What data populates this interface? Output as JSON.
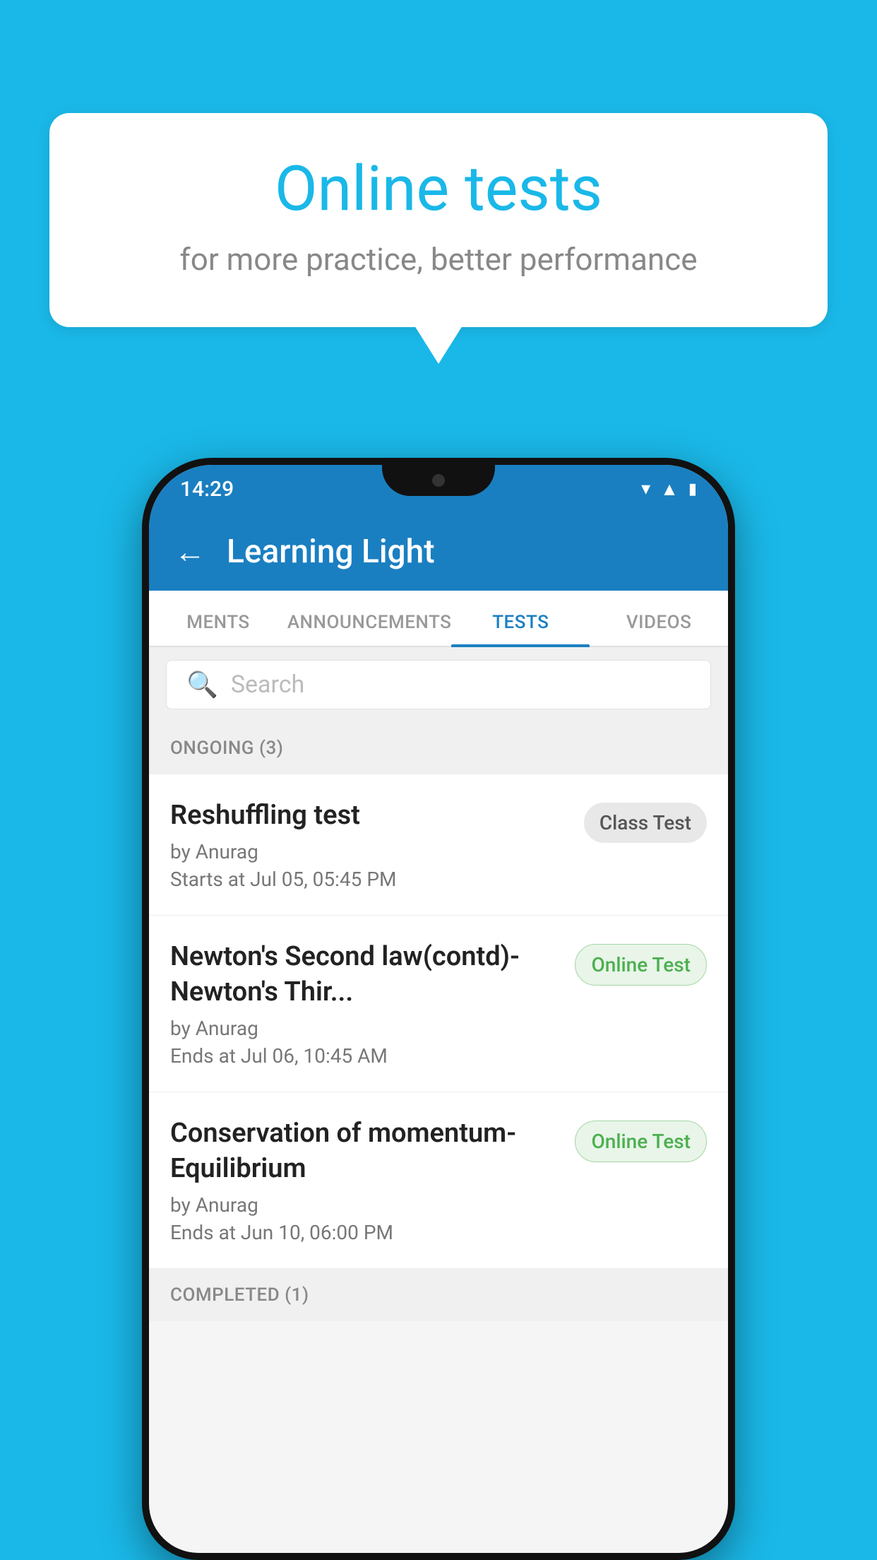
{
  "background_color": "#1ab8e8",
  "speech_bubble": {
    "title": "Online tests",
    "subtitle": "for more practice, better performance"
  },
  "phone": {
    "status_bar": {
      "time": "14:29",
      "icons": [
        "wifi",
        "signal",
        "battery"
      ]
    },
    "app_bar": {
      "title": "Learning Light",
      "back_label": "←"
    },
    "tabs": [
      {
        "label": "MENTS",
        "active": false
      },
      {
        "label": "ANNOUNCEMENTS",
        "active": false
      },
      {
        "label": "TESTS",
        "active": true
      },
      {
        "label": "VIDEOS",
        "active": false
      }
    ],
    "search": {
      "placeholder": "Search"
    },
    "ongoing_section": {
      "label": "ONGOING (3)"
    },
    "tests": [
      {
        "name": "Reshuffling test",
        "author": "by Anurag",
        "time_label": "Starts at",
        "time": "Jul 05, 05:45 PM",
        "badge": "Class Test",
        "badge_type": "class"
      },
      {
        "name": "Newton's Second law(contd)-Newton's Thir...",
        "author": "by Anurag",
        "time_label": "Ends at",
        "time": "Jul 06, 10:45 AM",
        "badge": "Online Test",
        "badge_type": "online"
      },
      {
        "name": "Conservation of momentum-Equilibrium",
        "author": "by Anurag",
        "time_label": "Ends at",
        "time": "Jun 10, 06:00 PM",
        "badge": "Online Test",
        "badge_type": "online"
      }
    ],
    "completed_section": {
      "label": "COMPLETED (1)"
    }
  }
}
